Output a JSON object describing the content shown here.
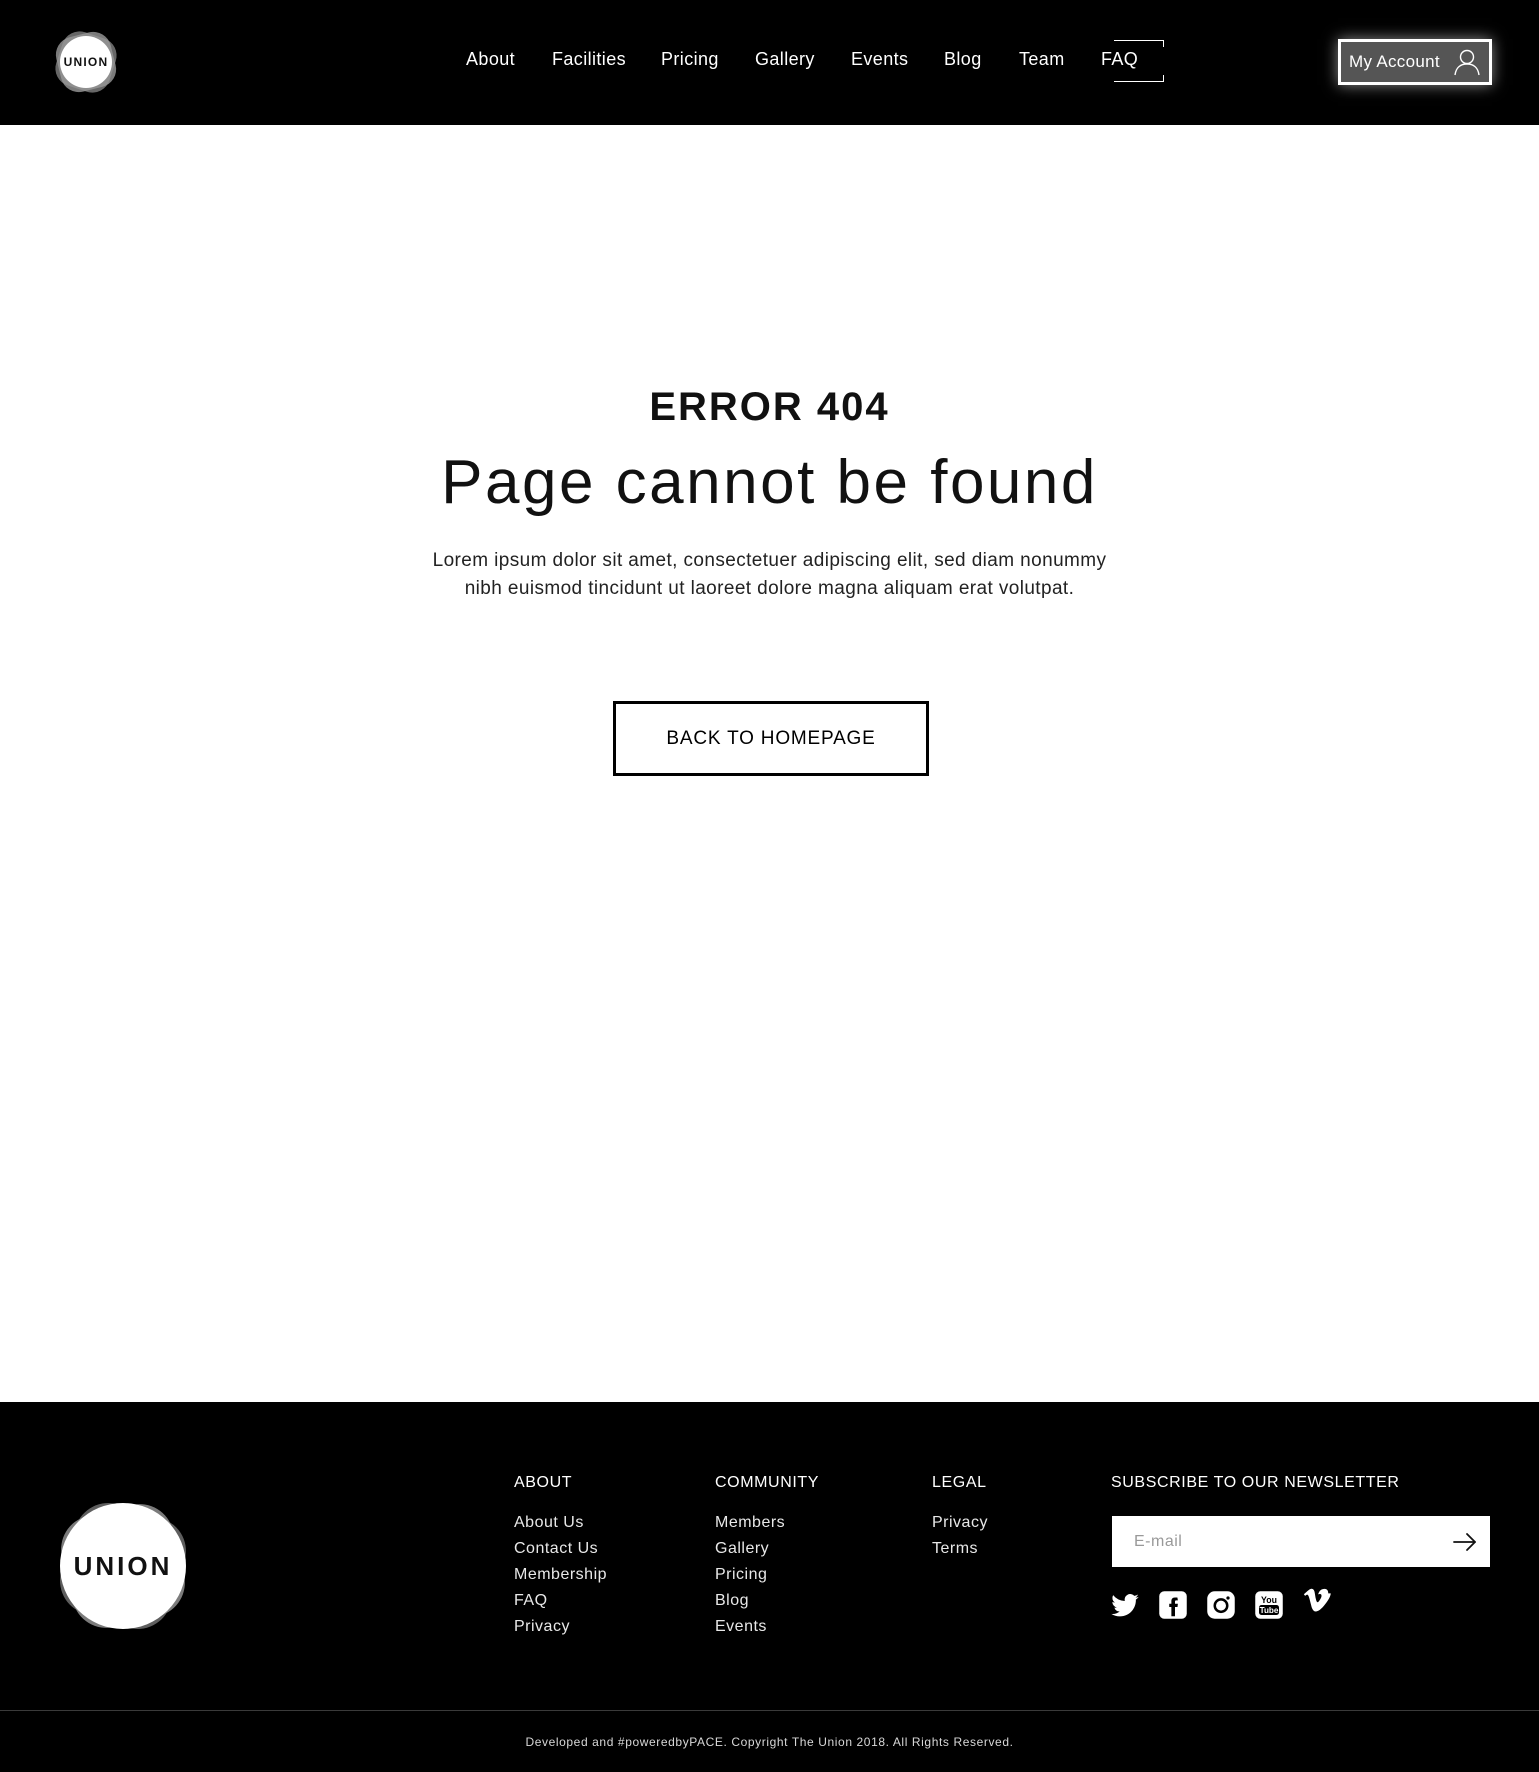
{
  "header": {
    "logo_text": "UNION",
    "nav": [
      {
        "label": "About"
      },
      {
        "label": "Facilities"
      },
      {
        "label": "Pricing"
      },
      {
        "label": "Gallery"
      },
      {
        "label": "Events"
      },
      {
        "label": "Blog"
      },
      {
        "label": "Team"
      },
      {
        "label": "FAQ"
      }
    ],
    "account_label": "My Account",
    "account_icon": "user-icon"
  },
  "main": {
    "error_code": "ERROR 404",
    "title": "Page cannot be found",
    "description_line1": "Lorem ipsum dolor sit amet, consectetuer adipiscing elit, sed diam nonummy",
    "description_line2": "nibh euismod tincidunt ut laoreet dolore magna aliquam erat volutpat.",
    "back_button": "BACK TO HOMEPAGE"
  },
  "footer": {
    "logo_text": "UNION",
    "columns": {
      "about": {
        "title": "ABOUT",
        "links": [
          "About Us",
          "Contact Us",
          "Membership",
          "FAQ",
          "Privacy"
        ]
      },
      "community": {
        "title": "COMMUNITY",
        "links": [
          "Members",
          "Gallery",
          "Pricing",
          "Blog",
          "Events"
        ]
      },
      "legal": {
        "title": "LEGAL",
        "links": [
          "Privacy",
          "Terms"
        ]
      }
    },
    "newsletter": {
      "title": "SUBSCRIBE TO OUR NEWSLETTER",
      "placeholder": "E-mail",
      "value": ""
    },
    "social": [
      "twitter-icon",
      "facebook-icon",
      "instagram-icon",
      "youtube-icon",
      "vimeo-icon"
    ],
    "youtube_badge": [
      "You",
      "Tube"
    ],
    "copyright": "Developed and #poweredbyPACE. Copyright The Union 2018. All Rights Reserved."
  },
  "colors": {
    "background": "#ffffff",
    "header_bg": "#000000",
    "footer_bg": "#000000",
    "text": "#111111",
    "account_button_bg": "#555555"
  }
}
